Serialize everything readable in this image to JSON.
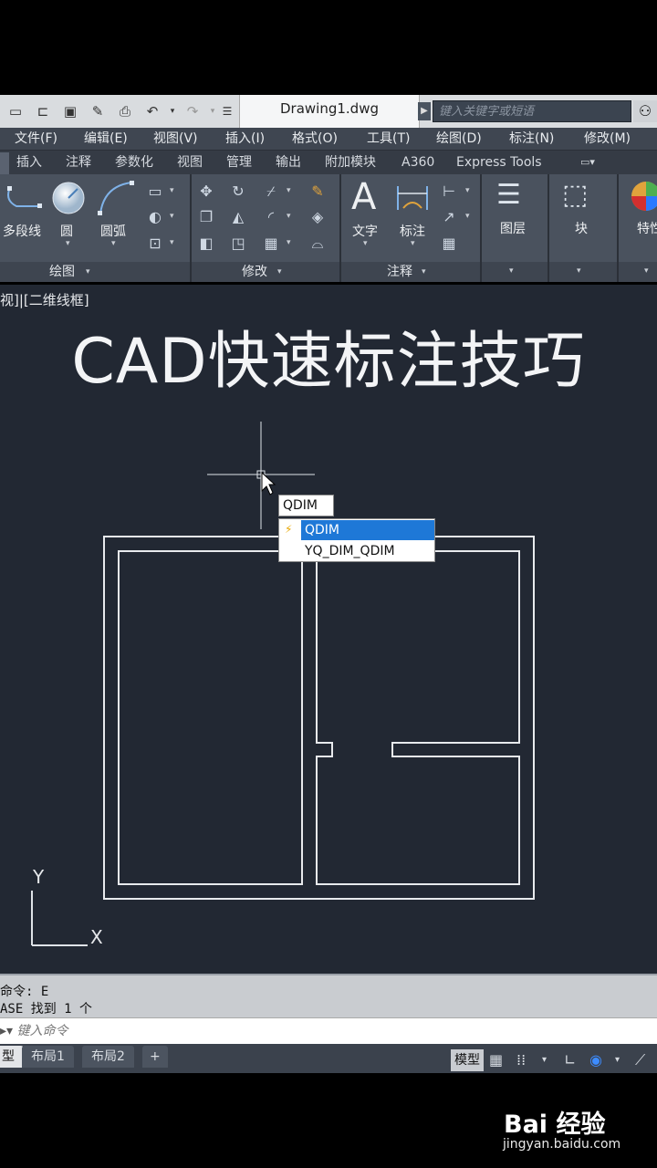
{
  "window": {
    "doc_tab": "Drawing1.dwg",
    "search_placeholder": "键入关键字或短语"
  },
  "menu": [
    "文件(F)",
    "编辑(E)",
    "视图(V)",
    "插入(I)",
    "格式(O)",
    "工具(T)",
    "绘图(D)",
    "标注(N)",
    "修改(M)"
  ],
  "ribbon_tabs": [
    "插入",
    "注释",
    "参数化",
    "视图",
    "管理",
    "输出",
    "附加模块",
    "A360",
    "Express Tools"
  ],
  "ribbon": {
    "draw_tools": [
      "多段线",
      "圆",
      "圆弧"
    ],
    "draw_panel": "绘图",
    "modify_panel": "修改",
    "annot_tools": [
      "文字",
      "标注"
    ],
    "annot_panel": "注释",
    "layer_label": "图层",
    "block_label": "块",
    "props_label": "特性"
  },
  "viewport": {
    "view_label": "视]|[二维线框]",
    "banner_title": "CAD快速标注技巧",
    "ucs_y": "Y",
    "ucs_x": "X"
  },
  "command": {
    "input_value": "QDIM",
    "suggestions": [
      "QDIM",
      "YQ_DIM_QDIM"
    ],
    "history": [
      "命令: E",
      "ASE 找到 1 个"
    ],
    "prompt_placeholder": "键入命令"
  },
  "status": {
    "layout_tabs": [
      "型",
      "布局1",
      "布局2",
      "+"
    ],
    "model_button": "模型"
  },
  "watermark": {
    "logo": "Bai 经验",
    "url": "jingyan.baidu.com"
  },
  "colors": {
    "canvas": "#222833",
    "highlight": "#1e78d7"
  }
}
